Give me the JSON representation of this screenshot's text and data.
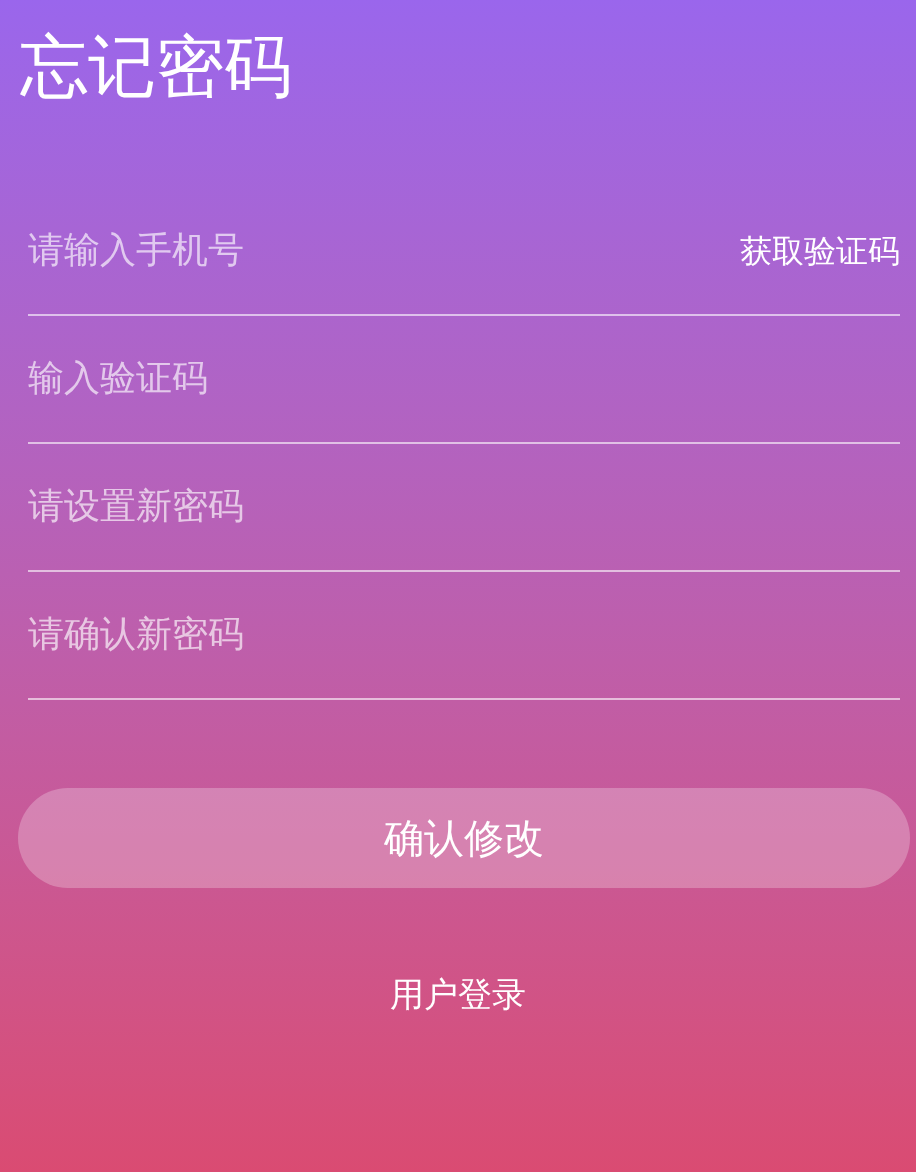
{
  "title": "忘记密码",
  "fields": [
    {
      "placeholder": "请输入手机号",
      "action": "获取验证码"
    },
    {
      "placeholder": "输入验证码"
    },
    {
      "placeholder": "请设置新密码"
    },
    {
      "placeholder": "请确认新密码"
    }
  ],
  "submit_button": "确认修改",
  "login_link": "用户登录"
}
